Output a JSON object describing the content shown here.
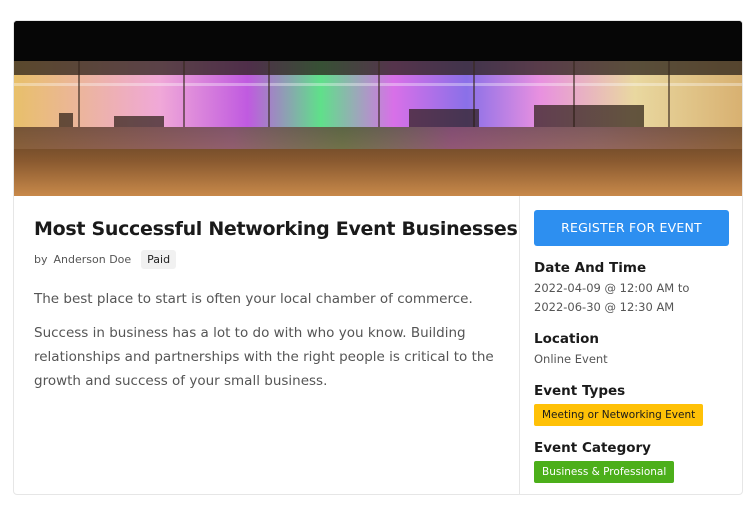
{
  "event": {
    "title": "Most Successful Networking Event Businesses",
    "by_label": "by",
    "author": "Anderson Doe",
    "price_badge": "Paid",
    "description": [
      "The best place to start is often your local chamber of commerce.",
      "Success in business has a lot to do with who you know. Building relationships and partnerships with the right people is critical to the growth and success of your small business."
    ]
  },
  "sidebar": {
    "register_label": "REGISTER FOR EVENT",
    "date_label": "Date And Time",
    "date_value_line1": "2022-04-09 @ 12:00 AM to",
    "date_value_line2": "2022-06-30 @ 12:30 AM",
    "location_label": "Location",
    "location_value": "Online Event",
    "event_types_label": "Event Types",
    "event_type_tag": "Meeting or Networking Event",
    "event_category_label": "Event Category",
    "event_category_tag": "Business & Professional"
  },
  "colors": {
    "register_button": "#2d8ff0",
    "event_type_tag": "#ffc107",
    "event_category_tag": "#4caf1a"
  }
}
